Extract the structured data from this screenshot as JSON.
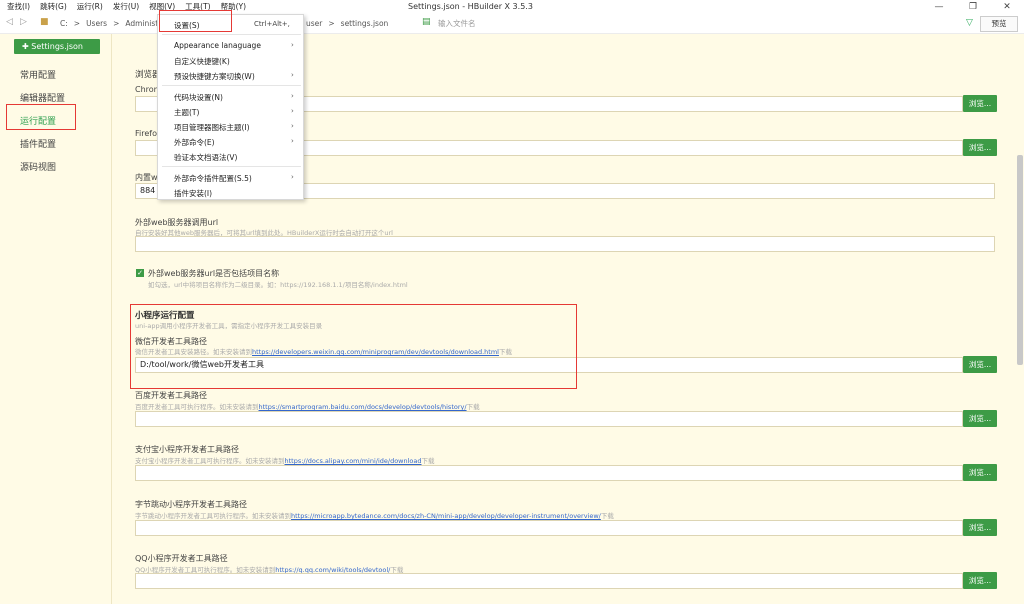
{
  "window": {
    "title": "Settings.json - HBuilder X 3.5.3",
    "controls": [
      "—",
      "❐",
      "✕"
    ]
  },
  "menubar": [
    {
      "label": "查找(I)"
    },
    {
      "label": "跳转(G)"
    },
    {
      "label": "运行(R)"
    },
    {
      "label": "发行(U)"
    },
    {
      "label": "视图(V)"
    },
    {
      "label": "工具(T)"
    },
    {
      "label": "帮助(Y)"
    }
  ],
  "toolbar": {
    "crumbs_left": [
      "C:",
      ">",
      "Users",
      ">",
      "Administrat"
    ],
    "crumbs_right": [
      "user",
      ">",
      "settings.json"
    ],
    "file_search_placeholder": "输入文件名",
    "preview_label": "预览"
  },
  "sidebar": {
    "file_badge": "Settings.json",
    "items": [
      {
        "label": "常用配置",
        "active": false
      },
      {
        "label": "编辑器配置",
        "active": false
      },
      {
        "label": "运行配置",
        "active": true
      },
      {
        "label": "插件配置",
        "active": false
      },
      {
        "label": "源码视图",
        "active": false
      }
    ]
  },
  "dropdown": {
    "items": [
      {
        "label": "设置(S)",
        "shortcut": "Ctrl+Alt+,"
      },
      {
        "label": "Appearance lanaguage",
        "submenu": true
      },
      {
        "label": "自定义快捷键(K)"
      },
      {
        "label": "预设快捷键方案切换(W)",
        "submenu": true
      },
      {
        "label": "代码块设置(N)",
        "submenu": true
      },
      {
        "label": "主题(T)",
        "submenu": true
      },
      {
        "label": "项目管理器图标主题(I)",
        "submenu": true
      },
      {
        "label": "外部命令(E)",
        "submenu": true
      },
      {
        "label": "验证本文档语法(V)"
      },
      {
        "label": "外部命令插件配置(S.5)",
        "submenu": true
      },
      {
        "label": "插件安装(I)"
      }
    ]
  },
  "settings": {
    "browser_section_title": "浏览器",
    "chrome_label": "Chrom",
    "firefox_label": "Firefo",
    "builtin_label": "内置w",
    "builtin_value": "884",
    "external_url": {
      "label": "外部web服务器调用url",
      "desc": "自行安装好其他web服务器后，可将其url填到此处。HBuilderX运行时会自动打开这个url"
    },
    "include_project_name": {
      "checked": true,
      "label": "外部web服务器url是否包括项目名称",
      "desc": "如勾选，url中将项目名称作为二级目录。如：https://192.168.1.1/项目名称/index.html"
    },
    "mini_program": {
      "title": "小程序运行配置",
      "desc": "uni-app调用小程序开发者工具，需指定小程序开发工具安装目录"
    },
    "paths": [
      {
        "label": "微信开发者工具路径",
        "desc_prefix": "微信开发者工具安装路径。如未安装请到",
        "link": "https://developers.weixin.qq.com/miniprogram/dev/devtools/download.html",
        "desc_suffix": "下载",
        "value": "D:/tool/work/微信web开发者工具"
      },
      {
        "label": "百度开发者工具路径",
        "desc_prefix": "百度开发者工具可执行程序。如未安装请到",
        "link": "https://smartprogram.baidu.com/docs/develop/devtools/history/",
        "desc_suffix": "下载",
        "value": ""
      },
      {
        "label": "支付宝小程序开发者工具路径",
        "desc_prefix": "支付宝小程序开发者工具可执行程序。如未安装请到",
        "link": "https://docs.alipay.com/mini/ide/download",
        "desc_suffix": "下载",
        "value": ""
      },
      {
        "label": "字节跳动小程序开发者工具路径",
        "desc_prefix": "字节跳动小程序开发者工具可执行程序。如未安装请到",
        "link": "https://microapp.bytedance.com/docs/zh-CN/mini-app/develop/developer-instrument/overview/",
        "desc_suffix": "下载",
        "value": ""
      },
      {
        "label": "QQ小程序开发者工具路径",
        "desc_prefix": "QQ小程序开发者工具可执行程序。如未安装请到",
        "link": "https://q.qq.com/wiki/tools/devtool/",
        "desc_suffix": "下载",
        "value": ""
      }
    ],
    "browse_label": "浏览..."
  },
  "colors": {
    "accent": "#3d9b46",
    "highlight": "#e53935",
    "background": "#fffbe6",
    "link": "#3366cc"
  }
}
